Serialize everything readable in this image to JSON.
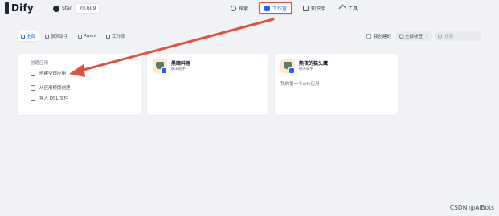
{
  "header": {
    "logo_text": "Dify",
    "github_label": "Star",
    "github_count": "70,609",
    "nav": [
      {
        "label": "探索",
        "icon": "compass-icon"
      },
      {
        "label": "工作室",
        "icon": "studio-icon",
        "active": true
      },
      {
        "label": "知识库",
        "icon": "book-icon"
      },
      {
        "label": "工具",
        "icon": "tool-icon"
      }
    ]
  },
  "filters": {
    "tabs": [
      {
        "label": "全部",
        "active": true
      },
      {
        "label": "聊天助手"
      },
      {
        "label": "Agent"
      },
      {
        "label": "工作流"
      }
    ],
    "created_by_me": "我创建的",
    "all_tags": "全部标签",
    "search_placeholder": "搜索"
  },
  "create_card": {
    "title": "创建应用",
    "items": [
      "创建空白应用",
      "从应用模版创建",
      "导入 DSL 文件"
    ]
  },
  "apps": [
    {
      "name": "黑暗料理",
      "type": "聊天助手",
      "description": ""
    },
    {
      "name": "熬夜的猫头鹰",
      "type": "聊天助手",
      "description": "我的第一个dify应用"
    }
  ],
  "watermark": "CSDN @AiBots",
  "colors": {
    "accent": "#2563eb",
    "annotation": "#e2513d",
    "background": "#f1f2f6"
  }
}
